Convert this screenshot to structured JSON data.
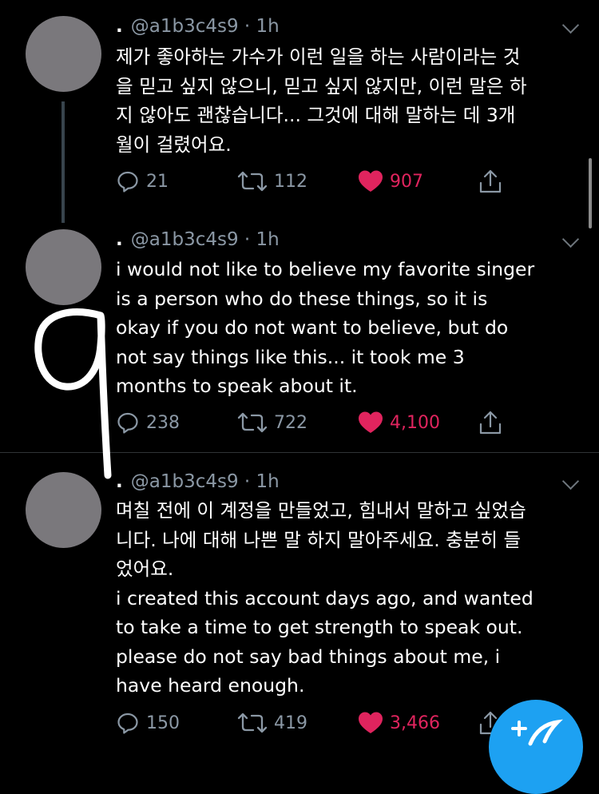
{
  "tweets": [
    {
      "handle": "@a1b3c4s9",
      "time": "1h",
      "text": "제가 좋아하는 가수가 이런 일을 하는 사람이라는 것\n을 믿고 싶지 않으니, 믿고 싶지 않지만, 이런 말은 하\n지 않아도 괜찮습니다... 그것에 대해 말하는 데 3개\n월이 걸렸어요.",
      "replies": "21",
      "retweets": "112",
      "likes": "907"
    },
    {
      "handle": "@a1b3c4s9",
      "time": "1h",
      "text": "i would not like to believe my favorite singer\nis a person who do these things, so it is\nokay if you do not want to believe, but do\nnot say things like this... it took me 3\nmonths to speak about it.",
      "replies": "238",
      "retweets": "722",
      "likes": "4,100"
    },
    {
      "handle": "@a1b3c4s9",
      "time": "1h",
      "text": "며칠 전에 이 계정을 만들었고, 힘내서 말하고 싶었습\n니다. 나에 대해 나쁜 말 하지 말아주세요. 충분히 들\n었어요.\ni created this account days ago, and wanted\nto take a time to get strength to speak out.\nplease do not say bad things about me, i\nhave heard enough.",
      "replies": "150",
      "retweets": "419",
      "likes": "3,466"
    }
  ],
  "colors": {
    "background": "#000000",
    "meta": "#8b98a5",
    "like": "#e0245e",
    "accent": "#1da1f2"
  },
  "icons": [
    "reply-icon",
    "retweet-icon",
    "heart-icon",
    "share-icon",
    "chevron-down-icon",
    "compose-icon"
  ]
}
